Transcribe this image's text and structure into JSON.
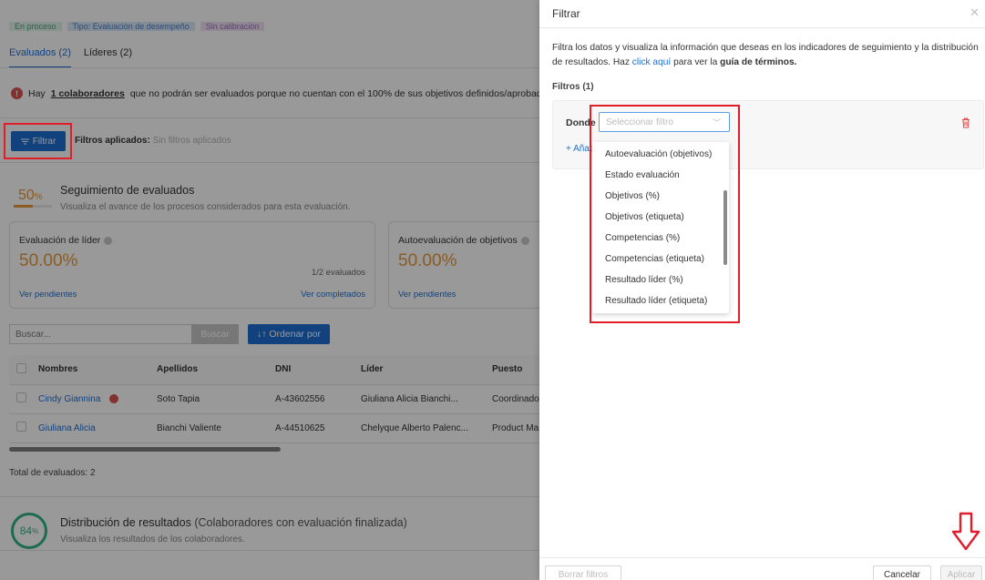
{
  "tags": [
    {
      "label": "En proceso",
      "bg": "#dff4e8",
      "color": "#4fa27a"
    },
    {
      "label": "Tipo: Evaluación de desempeño",
      "bg": "#dbe8f8",
      "color": "#4b7cc4"
    },
    {
      "label": "Sin calibración",
      "bg": "#efe3f6",
      "color": "#9b6bb9"
    }
  ],
  "tabs": [
    {
      "label": "Evaluados (2)",
      "active": true
    },
    {
      "label": "Líderes (2)",
      "active": false
    }
  ],
  "alert": {
    "prefix": "Hay",
    "link": "1 colaboradores",
    "text": "que no podrán ser evaluados porque no cuentan con el 100% de sus objetivos definidos/aprobados. Pod"
  },
  "filter_button": "Filtrar",
  "filters_applied": {
    "label": "Filtros aplicados:",
    "value": "Sin filtros aplicados"
  },
  "tracking": {
    "percent": "50",
    "percent_unit": "%",
    "progress": 0.5,
    "title": "Seguimiento de evaluados",
    "subtitle": "Visualiza el avance de los procesos considerados para esta evaluación."
  },
  "cards": [
    {
      "title": "Evaluación de líder",
      "value": "50.00%",
      "count": "1/2 evaluados",
      "link_left": "Ver pendientes",
      "link_right": "Ver completados"
    },
    {
      "title": "Autoevaluación de objetivos",
      "value": "50.00%",
      "link_left": "Ver pendientes"
    }
  ],
  "search": {
    "placeholder": "Buscar...",
    "button": "Buscar",
    "order": "Ordenar por"
  },
  "table": {
    "headers": [
      "Nombres",
      "Apellidos",
      "DNI",
      "Líder",
      "Puesto"
    ],
    "rows": [
      {
        "nombres": "Cindy Giannina",
        "apellidos": "Soto Tapia",
        "dni": "A-43602556",
        "lider": "Giuliana Alicia Bianchi...",
        "puesto": "Coordinado",
        "warn": true
      },
      {
        "nombres": "Giuliana Alicia",
        "apellidos": "Bianchi Valiente",
        "dni": "A-44510625",
        "lider": "Chelyque Alberto Palenc...",
        "puesto": "Product Ma",
        "warn": false
      }
    ]
  },
  "total": "Total de evaluados: 2",
  "distribution": {
    "percent": "84",
    "percent_unit": "%",
    "title": "Distribución de resultados",
    "title_suffix": "(Colaboradores con evaluación finalizada)",
    "subtitle": "Visualiza los resultados de los colaboradores."
  },
  "drawer": {
    "title": "Filtrar",
    "desc_1": "Filtra los datos y visualiza la información que deseas en los indicadores de seguimiento y la distribución de resultados. Haz",
    "desc_link": "click aquí",
    "desc_2": "para ver la",
    "desc_bold": "guía de términos.",
    "filters_count": "Filtros (1)",
    "donde": "Donde",
    "select_placeholder": "Seleccionar filtro",
    "add_filter": "+ Añadir filtro",
    "options": [
      "Autoevaluación (objetivos)",
      "Estado evaluación",
      "Objetivos (%)",
      "Objetivos (etiqueta)",
      "Competencias (%)",
      "Competencias (etiqueta)",
      "Resultado líder (%)",
      "Resultado líder (etiqueta)"
    ],
    "clear": "Borrar filtros",
    "cancel": "Cancelar",
    "apply": "Aplicar"
  },
  "colors": {
    "primary": "#1f6fd1",
    "accent_orange": "#e8983a",
    "accent_green": "#2fb48b",
    "highlight_red": "#e11d2a"
  }
}
